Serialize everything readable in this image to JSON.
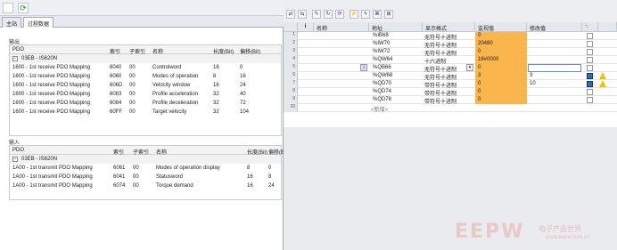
{
  "left": {
    "tabs": [
      "主站",
      "过程数据"
    ],
    "output_label": "输出",
    "input_label": "输入",
    "out_headers": [
      "PDO",
      "索引",
      "子索引",
      "名称",
      "长度(Bit)",
      "偏移(Bit)"
    ],
    "in_headers": [
      "PDO",
      "索引",
      "子索引",
      "名称",
      "长度(Bit)",
      "偏移(Bit)"
    ],
    "out_group": "03EB - IS620N",
    "in_group": "03EB - IS620N",
    "out_rows": [
      [
        "1600 - 1st receive PDO Mapping",
        "6040",
        "00",
        "Controlword",
        "16",
        "0"
      ],
      [
        "1600 - 1st receive PDO Mapping",
        "6060",
        "00",
        "Modes of operation",
        "8",
        "16"
      ],
      [
        "1600 - 1st receive PDO Mapping",
        "606D",
        "00",
        "Velocity window",
        "16",
        "24"
      ],
      [
        "1600 - 1st receive PDO Mapping",
        "6083",
        "00",
        "Profile acceleration",
        "32",
        "40"
      ],
      [
        "1600 - 1st receive PDO Mapping",
        "6084",
        "00",
        "Profile deceleration",
        "32",
        "72"
      ],
      [
        "1600 - 1st receive PDO Mapping",
        "60FF",
        "00",
        "Target velocity",
        "32",
        "104"
      ]
    ],
    "in_rows": [
      [
        "1A00 - 1st transmit PDO Mapping",
        "6061",
        "00",
        "Modes of operation display",
        "8",
        "0"
      ],
      [
        "1A00 - 1st transmit PDO Mapping",
        "6041",
        "00",
        "Statusword",
        "16",
        "8"
      ],
      [
        "1A00 - 1st transmit PDO Mapping",
        "6074",
        "00",
        "Torque demand",
        "16",
        "24"
      ]
    ]
  },
  "right": {
    "headers": [
      "i",
      "名称",
      "地址",
      "显示格式",
      "监视值",
      "修改值"
    ],
    "rows": [
      {
        "n": "1",
        "addr": "%IB68",
        "fmt": "无符号十进制",
        "mon": "0",
        "mod": "",
        "cb": false,
        "warn": false
      },
      {
        "n": "2",
        "addr": "%IW70",
        "fmt": "无符号十进制",
        "mon": "20480",
        "mod": "",
        "cb": false,
        "warn": false
      },
      {
        "n": "3",
        "addr": "%IW72",
        "fmt": "无符号十进制",
        "mon": "0",
        "mod": "",
        "cb": false,
        "warn": false
      },
      {
        "n": "4",
        "addr": "%QW64",
        "fmt": "十六进制",
        "mon": "16#0000",
        "mod": "",
        "cb": false,
        "warn": false
      },
      {
        "n": "5",
        "addr": "%QB66",
        "fmt": "无符号十进制",
        "mon": "0",
        "mod": "",
        "cb": false,
        "warn": false
      },
      {
        "n": "6",
        "addr": "%QW68",
        "fmt": "无符号十进制",
        "mon": "3",
        "mod": "3",
        "cb": true,
        "warn": true
      },
      {
        "n": "7",
        "addr": "%QD70",
        "fmt": "带符号十进制",
        "mon": "0",
        "mod": "10",
        "cb": true,
        "warn": true
      },
      {
        "n": "8",
        "addr": "%QD74",
        "fmt": "带符号十进制",
        "mon": "0",
        "mod": "",
        "cb": false,
        "warn": false
      },
      {
        "n": "9",
        "addr": "%QD78",
        "fmt": "带符号十进制",
        "mon": "0",
        "mod": "",
        "cb": false,
        "warn": false
      },
      {
        "n": "10",
        "addr": "<新增>",
        "fmt": "",
        "mon": "",
        "mod": "",
        "cb": false,
        "warn": false
      }
    ]
  },
  "watermark": {
    "logo": "EEPW",
    "cn": "电子产品世界",
    "url": "www.eepw.com.cn"
  },
  "colors": {
    "monitor": "#fbb54d",
    "checkbox": "#2a6fb5"
  }
}
